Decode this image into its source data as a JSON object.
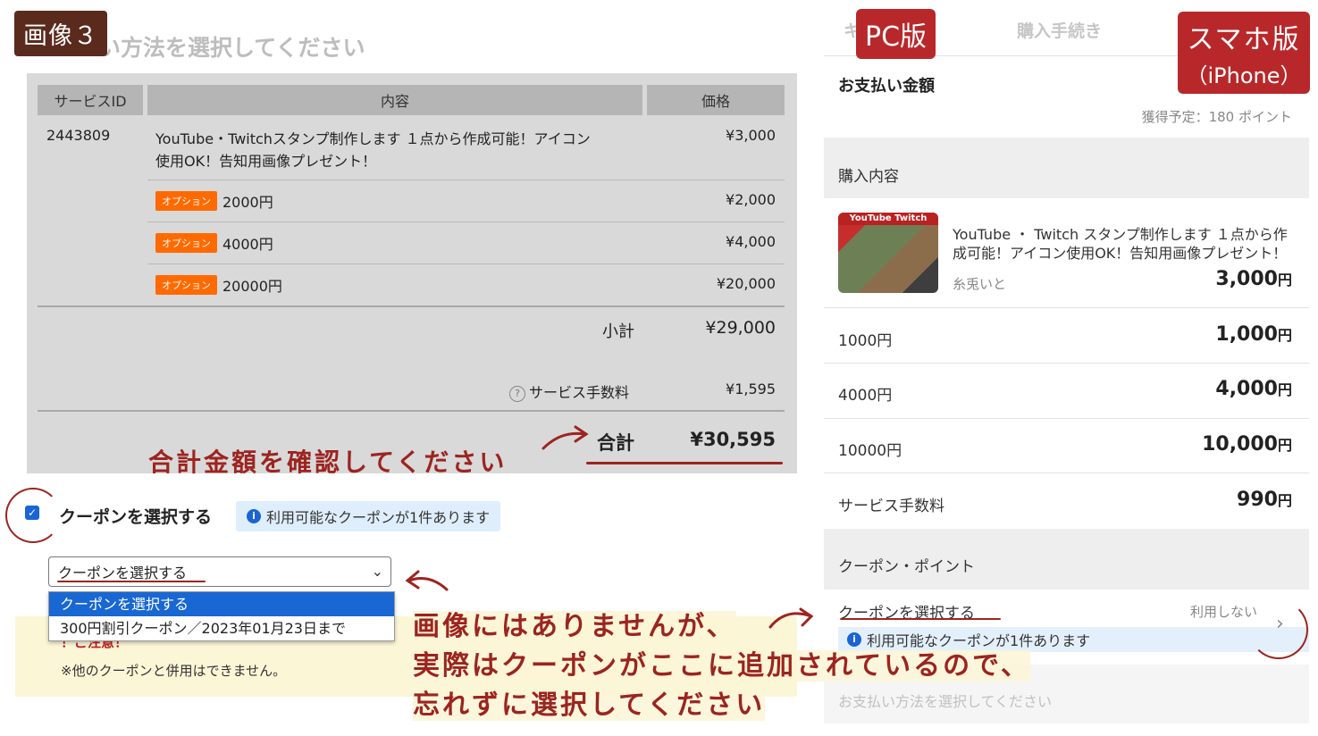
{
  "labels": {
    "image_label": "画像３",
    "pc_badge": "PC版",
    "sp_badge_line1": "スマホ版",
    "sp_badge_line2": "（iPhone）"
  },
  "pc": {
    "faded_heading": "い方法を選択してください",
    "table": {
      "headers": [
        "サービスID",
        "内容",
        "価格"
      ],
      "service_id": "2443809",
      "main_item": {
        "line1": "YouTube・Twitchスタンプ制作します １点から作成可能！アイコン",
        "line2": "使用OK！告知用画像プレゼント！",
        "price": "¥3,000"
      },
      "option_badge": "オプション",
      "options": [
        {
          "label": "2000円",
          "price": "¥2,000"
        },
        {
          "label": "4000円",
          "price": "¥4,000"
        },
        {
          "label": "20000円",
          "price": "¥20,000"
        }
      ],
      "subtotal_label": "小計",
      "subtotal": "¥29,000",
      "fee_label": "サービス手数料",
      "fee": "¥1,595",
      "total_label": "合計",
      "total": "¥30,595"
    },
    "annotation_total": "合計金額を確認してください",
    "coupon_label": "クーポンを選択する",
    "coupon_info": "利用可能なクーポンが1件あります",
    "coupon_select_value": "クーポンを選択する",
    "coupon_options": [
      "クーポンを選択する",
      "300円割引クーポン／2023年01月23日まで"
    ],
    "note_head": "！ご注意！",
    "note_body": "※他のクーポンと併用はできません。",
    "annotation_bottom": [
      "画像にはありませんが、",
      "実際はクーポンがここに追加されているので、",
      "忘れずに選択してください"
    ]
  },
  "sp": {
    "tab_left": "キ",
    "tab_middle": "購入手続き",
    "amount_label": "お支払い金額",
    "points": "獲得予定：180 ポイント",
    "purchase_header": "購入内容",
    "thumb_title": "YouTube Twitch",
    "item_title_line1": "YouTube ・ Twitch スタンプ制作します １点から作",
    "item_title_line2": "成可能！アイコン使用OK！告知用画像プレゼント！",
    "seller": "糸兎いと",
    "item_price": "3,000",
    "yen": "円",
    "rows": [
      {
        "label": "1000円",
        "price": "1,000"
      },
      {
        "label": "4000円",
        "price": "4,000"
      },
      {
        "label": "10000円",
        "price": "10,000"
      },
      {
        "label": "サービス手数料",
        "price": "990"
      }
    ],
    "coupon_header": "クーポン・ポイント",
    "coupon_select": "クーポンを選択する",
    "coupon_unused": "利用しない",
    "coupon_info": "利用可能なクーポンが1件あります",
    "payment_placeholder": "お支払い方法を選択してください"
  }
}
